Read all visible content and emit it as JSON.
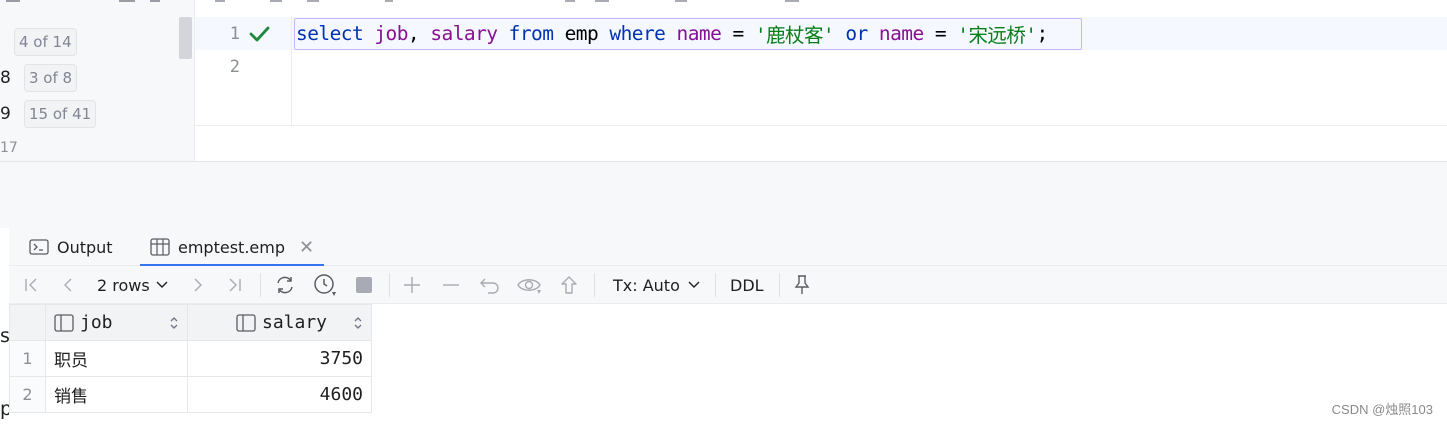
{
  "left_panel": {
    "rows": [
      {
        "num": "",
        "badge": "4 of 14"
      },
      {
        "num": "8",
        "badge": "3 of 8"
      },
      {
        "num": "9",
        "badge": "15 of 41"
      },
      {
        "num": "17",
        "badge": ""
      }
    ]
  },
  "editor": {
    "line_numbers": [
      "1",
      "2"
    ],
    "status": "check-icon",
    "code": {
      "t1": "select",
      "t2": " ",
      "t3": "job",
      "t4": ", ",
      "t5": "salary",
      "t6": " ",
      "t7": "from",
      "t8": " emp ",
      "t9": "where",
      "t10": " ",
      "t11": "name",
      "t12": " = ",
      "t13": "'鹿杖客'",
      "t14": " ",
      "t15": "or",
      "t16": " ",
      "t17": "name",
      "t18": " = ",
      "t19": "'宋远桥'",
      "t20": ";"
    }
  },
  "results": {
    "tabs": [
      {
        "label": "Output",
        "icon": "console-icon"
      },
      {
        "label": "emptest.emp",
        "icon": "table-icon"
      }
    ],
    "toolbar": {
      "rows_label": "2 rows",
      "tx_label": "Tx: Auto",
      "ddl_label": "DDL"
    },
    "columns": [
      "job",
      "salary"
    ],
    "rows": [
      {
        "n": "1",
        "job": "职员",
        "salary": "3750"
      },
      {
        "n": "2",
        "job": "销售",
        "salary": "4600"
      }
    ]
  },
  "stray": {
    "s": "s",
    "p": "p"
  },
  "watermark": "CSDN @烛照103",
  "colors": {
    "keyword": "#0033b3",
    "column": "#871094",
    "string": "#067d17",
    "accent": "#3574f0",
    "success": "#208a3c"
  }
}
